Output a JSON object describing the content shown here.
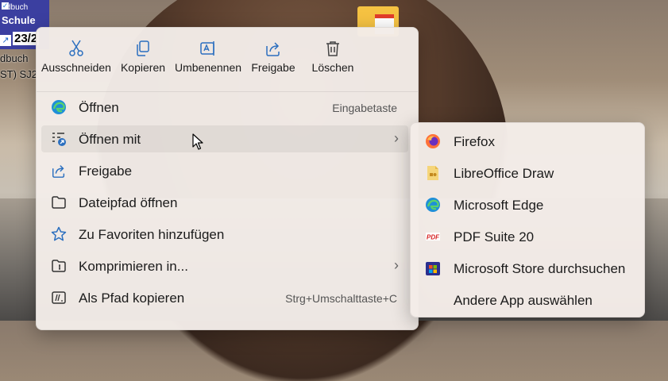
{
  "desktop": {
    "tile": {
      "line1": "dbuch",
      "line2": "Schule",
      "line3": "23/2"
    },
    "label1": "dbuch",
    "label2": "ST) SJ2"
  },
  "menu": {
    "quick_actions": [
      {
        "label": "Ausschneiden",
        "icon": "scissors-icon"
      },
      {
        "label": "Kopieren",
        "icon": "copy-icon"
      },
      {
        "label": "Umbenennen",
        "icon": "rename-icon"
      },
      {
        "label": "Freigabe",
        "icon": "share-icon"
      },
      {
        "label": "Löschen",
        "icon": "trash-icon"
      }
    ],
    "items": [
      {
        "label": "Öffnen",
        "accel": "Eingabetaste",
        "icon": "edge-icon"
      },
      {
        "label": "Öffnen mit",
        "accel": "",
        "icon": "open-with-icon",
        "submenu": true
      },
      {
        "label": "Freigabe",
        "accel": "",
        "icon": "share-icon"
      },
      {
        "label": "Dateipfad öffnen",
        "accel": "",
        "icon": "folder-icon"
      },
      {
        "label": "Zu Favoriten hinzufügen",
        "accel": "",
        "icon": "star-icon"
      },
      {
        "label": "Komprimieren in...",
        "accel": "",
        "icon": "zip-folder-icon",
        "submenu": true
      },
      {
        "label": "Als Pfad kopieren",
        "accel": "Strg+Umschalttaste+C",
        "icon": "copy-path-icon"
      }
    ]
  },
  "submenu": {
    "items": [
      {
        "label": "Firefox",
        "icon": "firefox-icon"
      },
      {
        "label": "LibreOffice Draw",
        "icon": "libreoffice-draw-icon"
      },
      {
        "label": "Microsoft Edge",
        "icon": "edge-icon"
      },
      {
        "label": "PDF Suite 20",
        "icon": "pdf-suite-icon"
      },
      {
        "label": "Microsoft Store durchsuchen",
        "icon": "store-icon"
      },
      {
        "label": "Andere App auswählen",
        "icon": ""
      }
    ]
  },
  "colors": {
    "accent": "#2b6fbf",
    "menu_bg": "#f3ece8"
  }
}
